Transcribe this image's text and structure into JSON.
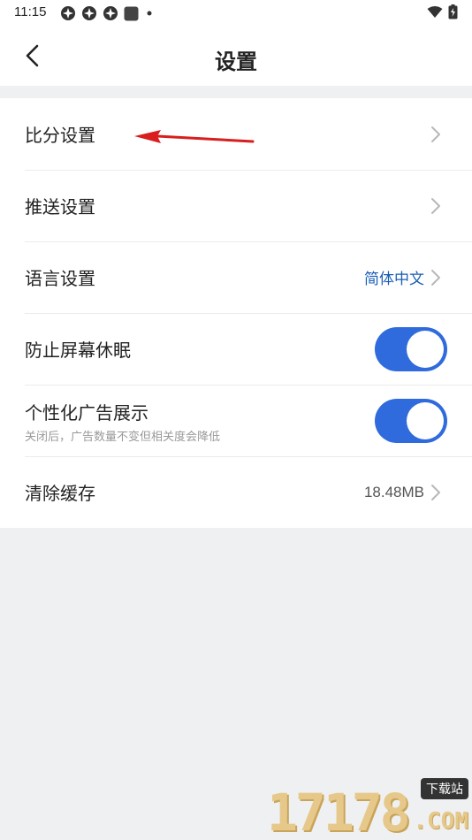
{
  "status_bar": {
    "time": "11:15",
    "left_icons": [
      "app-icon",
      "app-icon",
      "app-icon",
      "square-icon",
      "dot-icon"
    ],
    "right_icons": [
      "wifi-icon",
      "battery-icon"
    ]
  },
  "header": {
    "title": "设置",
    "back_icon": "chevron-left-icon"
  },
  "settings": {
    "score": {
      "label": "比分设置"
    },
    "push": {
      "label": "推送设置"
    },
    "language": {
      "label": "语言设置",
      "value": "简体中文"
    },
    "screen_awake": {
      "label": "防止屏幕休眠",
      "enabled": true
    },
    "personalized_ads": {
      "label": "个性化广告展示",
      "sub": "关闭后，广告数量不变但相关度会降低",
      "enabled": true
    },
    "clear_cache": {
      "label": "清除缓存",
      "value": "18.48MB"
    }
  },
  "colors": {
    "toggle_on": "#2f6bdc",
    "accent_text": "#1a5fb4",
    "annotation_arrow": "#d81e1e",
    "background": "#eff0f2"
  },
  "watermark": {
    "number": "17178",
    "tag": "下载站",
    "suffix": ".COM"
  }
}
